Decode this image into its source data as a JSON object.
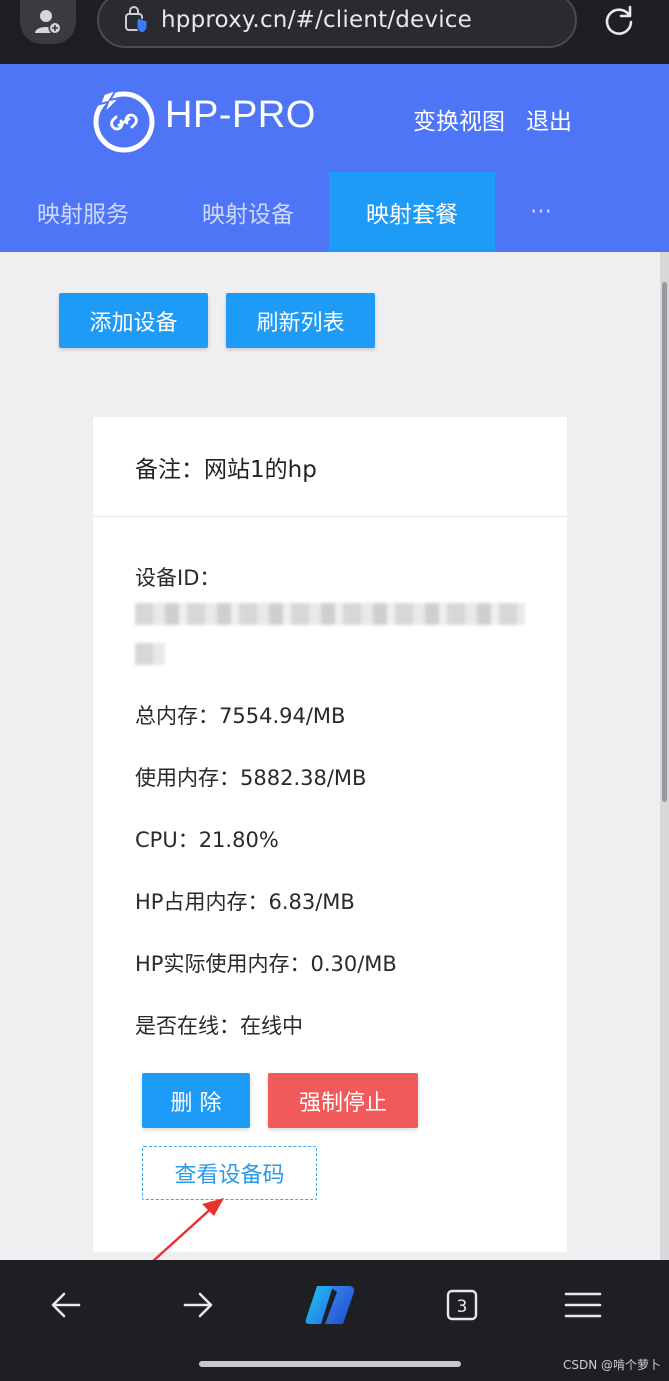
{
  "browser": {
    "url": "hpproxy.cn/#/client/device",
    "tab_count": "3"
  },
  "header": {
    "logo_text": "HP-PRO",
    "switch_view": "变换视图",
    "logout": "退出"
  },
  "nav": {
    "tabs": [
      {
        "label": "映射服务",
        "active": false
      },
      {
        "label": "映射设备",
        "active": false
      },
      {
        "label": "映射套餐",
        "active": true
      },
      {
        "label": "···",
        "active": false
      }
    ]
  },
  "toolbar": {
    "add_device": "添加设备",
    "refresh_list": "刷新列表"
  },
  "device_card": {
    "remark": "备注：网站1的hp",
    "device_id_label": "设备ID：",
    "total_memory": "总内存：7554.94/MB",
    "used_memory": "使用内存：5882.38/MB",
    "cpu": "CPU：21.80%",
    "hp_memory": "HP占用内存：6.83/MB",
    "hp_actual_memory": "HP实际使用内存：0.30/MB",
    "online_status": "是否在线：在线中",
    "delete_label": "删 除",
    "force_stop_label": "强制停止",
    "view_code_label": "查看设备码"
  },
  "watermark": "CSDN @啃个萝卜",
  "colors": {
    "header_blue": "#4e75f6",
    "active_tab": "#1e9bf6",
    "primary_button": "#1e9bf6",
    "danger_button": "#f05a5a",
    "annotation_red": "#e8322e"
  }
}
